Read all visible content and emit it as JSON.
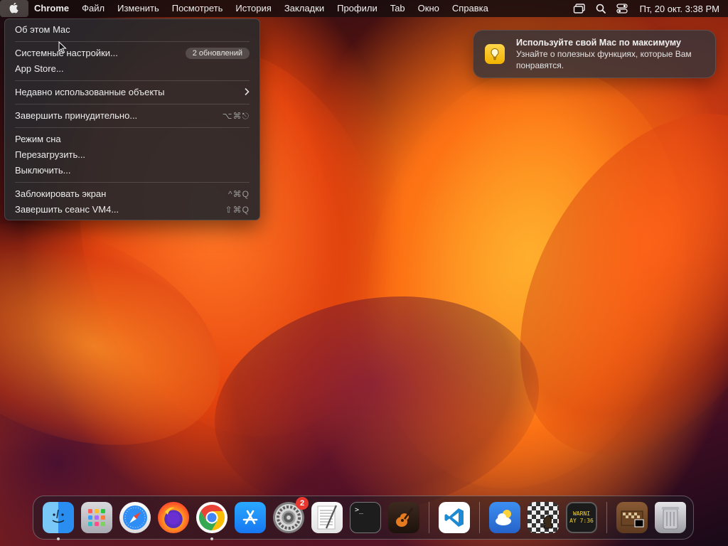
{
  "menubar": {
    "app_name": "Chrome",
    "items": [
      "Файл",
      "Изменить",
      "Посмотреть",
      "История",
      "Закладки",
      "Профили",
      "Tab",
      "Окно",
      "Справка"
    ],
    "clock": "Пт, 20 окт.  3:38 PM",
    "status_icons": [
      "screen-mirroring-icon",
      "search-icon",
      "control-center-icon"
    ]
  },
  "apple_menu": {
    "about": "Об этом Mac",
    "settings": "Системные настройки...",
    "settings_badge": "2 обновлений",
    "app_store": "App Store...",
    "recent": "Недавно использованные объекты",
    "force_quit": "Завершить принудительно...",
    "force_quit_shortcut": "⌥⌘⎋",
    "sleep": "Режим сна",
    "restart": "Перезагрузить...",
    "shutdown": "Выключить...",
    "lock": "Заблокировать экран",
    "lock_shortcut": "^⌘Q",
    "logout": "Завершить сеанс VM4...",
    "logout_shortcut": "⇧⌘Q"
  },
  "notification": {
    "title": "Используйте свой Mac по максимуму",
    "body": "Узнайте о полезных функциях, которые Вам понравятся.",
    "icon": "lightbulb-icon"
  },
  "dock": {
    "settings_badge": "2",
    "terminal_prompt": ">_",
    "console_text": "WARNI\nAY 7:36",
    "apps": [
      "finder",
      "launchpad",
      "safari",
      "firefox",
      "chrome",
      "app-store",
      "system-settings",
      "textedit",
      "terminal",
      "garageband",
      "vscode",
      "weather",
      "chess",
      "console",
      "chess-folder",
      "trash"
    ],
    "running": [
      "finder",
      "chrome"
    ]
  },
  "colors": {
    "menubar_bg": "#190e0e",
    "menu_bg": "#2a282a",
    "badge_red": "#e8372f",
    "notif_icon": "#ffd54a"
  }
}
